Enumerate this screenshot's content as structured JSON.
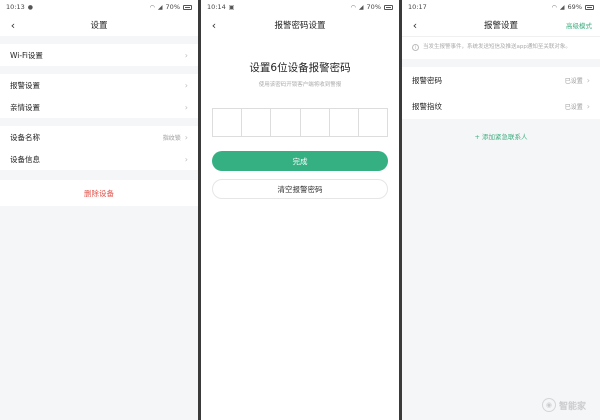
{
  "screen1": {
    "status": {
      "time": "10:13",
      "battery": "70%"
    },
    "title": "设置",
    "groups": [
      [
        {
          "label": "Wi-Fi设置",
          "value": ""
        }
      ],
      [
        {
          "label": "报警设置",
          "value": ""
        },
        {
          "label": "亲情设置",
          "value": ""
        }
      ],
      [
        {
          "label": "设备名称",
          "value": "指纹锁"
        },
        {
          "label": "设备信息",
          "value": ""
        }
      ]
    ],
    "delete_label": "删除设备"
  },
  "screen2": {
    "status": {
      "time": "10:14",
      "battery": "70%"
    },
    "title": "报警密码设置",
    "heading": "设置6位设备报警密码",
    "subtitle": "使用该密码开锁客户端将收到警报",
    "confirm_label": "完成",
    "clear_label": "清空报警密码"
  },
  "screen3": {
    "status": {
      "time": "10:17",
      "battery": "69%"
    },
    "title": "报警设置",
    "action_label": "高级模式",
    "notice": "当发生报警事件，系统发送短信及推送app通知至关联对象。",
    "rows": [
      {
        "label": "报警密码",
        "value": "已设置"
      },
      {
        "label": "报警指纹",
        "value": "已设置"
      }
    ],
    "add_contact_label": "+ 添加紧急联系人"
  },
  "watermark": "智能家"
}
